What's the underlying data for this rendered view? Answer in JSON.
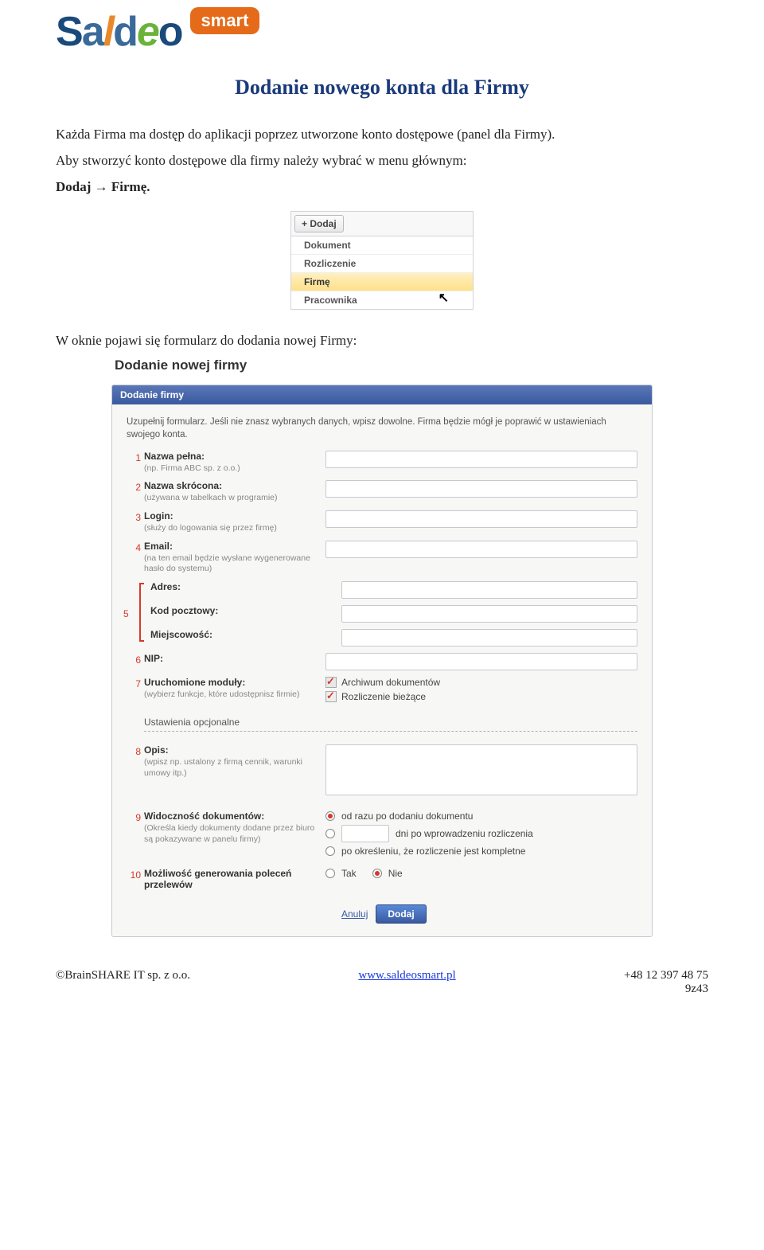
{
  "logo": {
    "smart": "smart"
  },
  "title": "Dodanie nowego konta dla Firmy",
  "intro1a": "Każda Firma ma dostęp do aplikacji poprzez utworzone konto dostępowe (panel dla Firmy).",
  "intro1b": "Aby stworzyć konto dostępowe dla firmy należy wybrać w menu głównym:",
  "intro1c": "Dodaj → Firmę.",
  "dropdown": {
    "header": "+ Dodaj",
    "items": [
      "Dokument",
      "Rozliczenie",
      "Firmę",
      "Pracownika"
    ]
  },
  "intro2": "W oknie pojawi się formularz do dodania nowej Firmy:",
  "form": {
    "heading": "Dodanie nowej firmy",
    "panel_title": "Dodanie firmy",
    "instruction": "Uzupełnij formularz. Jeśli nie znasz wybranych danych, wpisz dowolne. Firma będzie mógł je poprawić w ustawieniach swojego konta.",
    "n1": "1",
    "f1_label": "Nazwa pełna:",
    "f1_hint": "(np. Firma ABC sp. z o.o.)",
    "n2": "2",
    "f2_label": "Nazwa skrócona:",
    "f2_hint": "(używana w tabelkach w programie)",
    "n3": "3",
    "f3_label": "Login:",
    "f3_hint": "(służy do logowania się przez firmę)",
    "n4": "4",
    "f4_label": "Email:",
    "f4_hint": "(na ten email będzie wysłane wygenerowane hasło do systemu)",
    "n5": "5",
    "f5a_label": "Adres:",
    "f5b_label": "Kod pocztowy:",
    "f5c_label": "Miejscowość:",
    "n6": "6",
    "f6_label": "NIP:",
    "n7": "7",
    "f7_label": "Uruchomione moduły:",
    "f7_hint": "(wybierz funkcje, które udostępnisz firmie)",
    "f7_opt1": "Archiwum dokumentów",
    "f7_opt2": "Rozliczenie bieżące",
    "optional": "Ustawienia opcjonalne",
    "n8": "8",
    "f8_label": "Opis:",
    "f8_hint": "(wpisz np. ustalony z firmą cennik, warunki umowy itp.)",
    "n9": "9",
    "f9_label": "Widoczność dokumentów:",
    "f9_hint": "(Określa kiedy dokumenty dodane przez biuro są pokazywane w panelu firmy)",
    "f9_r1": "od razu po dodaniu dokumentu",
    "f9_r2a": "dni po wprowadzeniu rozliczenia",
    "f9_r3": "po określeniu, że rozliczenie jest kompletne",
    "n10": "10",
    "f10_label": "Możliwość generowania poleceń przelewów",
    "f10_yes": "Tak",
    "f10_no": "Nie",
    "cancel": "Anuluj",
    "submit": "Dodaj"
  },
  "footer": {
    "left": "©BrainSHARE IT sp. z o.o.",
    "center": "www.saldeosmart.pl",
    "right1": "+48 12 397 48 75",
    "right2": "9z43"
  }
}
